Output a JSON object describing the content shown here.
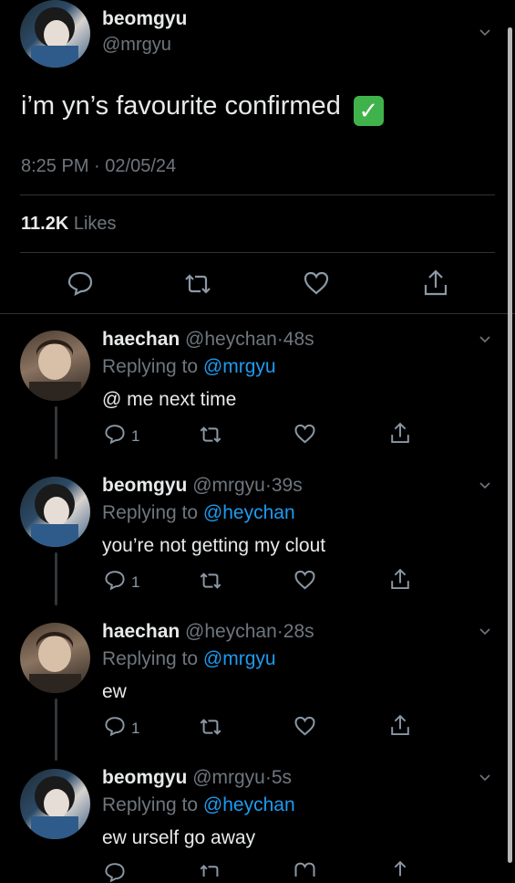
{
  "main_tweet": {
    "display_name": "beomgyu",
    "handle": "@mrgyu",
    "text": "i’m yn’s favourite confirmed",
    "emoji": "✓",
    "time": "8:25 PM",
    "date": "02/05/24",
    "likes_count": "11.2K",
    "likes_label": "Likes"
  },
  "replies": [
    {
      "display_name": "haechan",
      "handle": "@heychan",
      "time": "48s",
      "replying_label": "Replying to",
      "replying_to": "@mrgyu",
      "text": "@ me next time",
      "reply_count": "1"
    },
    {
      "display_name": "beomgyu",
      "handle": "@mrgyu",
      "time": "39s",
      "replying_label": "Replying to",
      "replying_to": "@heychan",
      "text": "you’re not getting my clout",
      "reply_count": "1"
    },
    {
      "display_name": "haechan",
      "handle": "@heychan",
      "time": "28s",
      "replying_label": "Replying to",
      "replying_to": "@mrgyu",
      "text": "ew",
      "reply_count": "1"
    },
    {
      "display_name": "beomgyu",
      "handle": "@mrgyu",
      "time": "5s",
      "replying_label": "Replying to",
      "replying_to": "@heychan",
      "text": "ew urself go away"
    }
  ],
  "separator": "·",
  "colors": {
    "background": "#000000",
    "text": "#e7e9ea",
    "secondary": "#6e767d",
    "link": "#1d9bf0",
    "check": "#40b24b"
  }
}
